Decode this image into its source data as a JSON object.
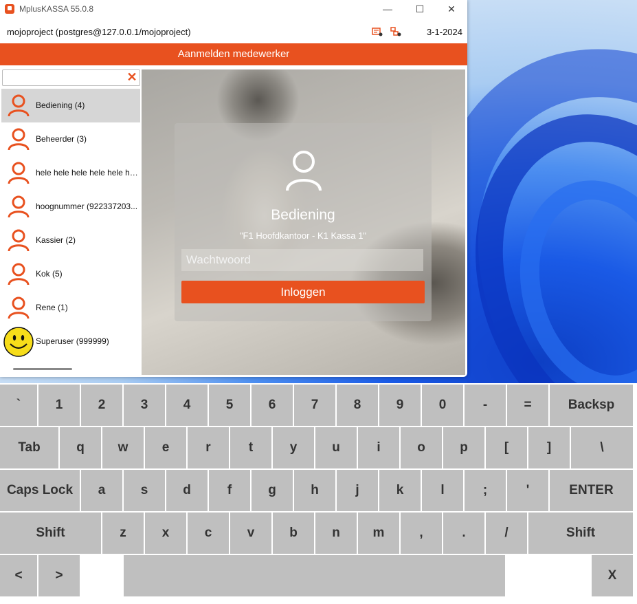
{
  "window": {
    "app_title": "MplusKASSA 55.0.8",
    "minimize": "—",
    "maximize": "☐",
    "close": "✕",
    "connection": "mojoproject (postgres@127.0.0.1/mojoproject)",
    "date": "3-1-2024",
    "header": "Aanmelden medewerker",
    "accent_color": "#e8511f"
  },
  "search": {
    "value": "",
    "placeholder": "",
    "clear_icon": "close-icon"
  },
  "users": [
    {
      "label": "Bediening (4)",
      "icon": "user-icon",
      "selected": true
    },
    {
      "label": "Beheerder (3)",
      "icon": "user-icon"
    },
    {
      "label": "hele hele hele hele hele he...",
      "icon": "user-icon"
    },
    {
      "label": "hoognummer (922337203...",
      "icon": "user-icon"
    },
    {
      "label": "Kassier (2)",
      "icon": "user-icon"
    },
    {
      "label": "Kok (5)",
      "icon": "user-icon"
    },
    {
      "label": "Rene (1)",
      "icon": "user-icon"
    },
    {
      "label": "Superuser (999999)",
      "icon": "smiley-icon"
    }
  ],
  "login": {
    "name": "Bediening",
    "location": "\"F1 Hoofdkantoor - K1 Kassa 1\"",
    "password_value": "",
    "password_placeholder": "Wachtwoord",
    "button": "Inloggen"
  },
  "keyboard": {
    "row1": [
      "`",
      "1",
      "2",
      "3",
      "4",
      "5",
      "6",
      "7",
      "8",
      "9",
      "0",
      "-",
      "=",
      "Backsp"
    ],
    "row2": [
      "Tab",
      "q",
      "w",
      "e",
      "r",
      "t",
      "y",
      "u",
      "i",
      "o",
      "p",
      "[",
      "]",
      "\\"
    ],
    "row3": [
      "Caps Lock",
      "a",
      "s",
      "d",
      "f",
      "g",
      "h",
      "j",
      "k",
      "l",
      ";",
      "'",
      "ENTER"
    ],
    "row4": [
      "Shift",
      "z",
      "x",
      "c",
      "v",
      "b",
      "n",
      "m",
      ",",
      ".",
      "/",
      "Shift"
    ],
    "row5": [
      "<",
      ">",
      "",
      "",
      "",
      "X"
    ]
  }
}
